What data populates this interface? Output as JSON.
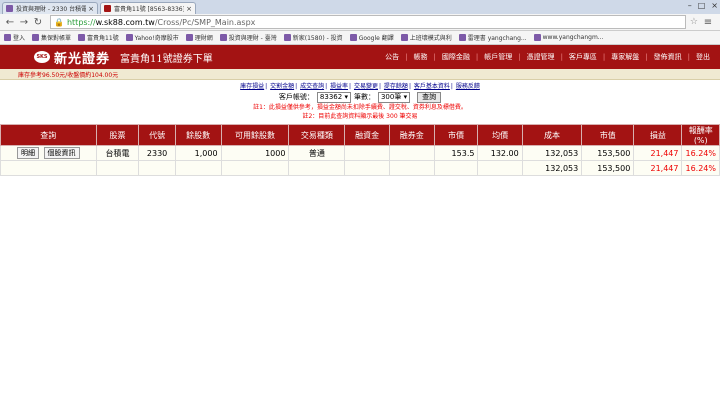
{
  "browser": {
    "tabs": [
      {
        "label": "投資與理財 - 2330 台積電..."
      },
      {
        "label": "富貴角11號 [8563-8336]"
      }
    ],
    "url_scheme": "https://",
    "url_host": "w.sk88.com.tw",
    "url_path": "/Cross/Pc/SMP_Main.aspx",
    "bookmarks": [
      "登入",
      "集保對帳單",
      "富貴角11號",
      "Yahoo!奇摩股市",
      "理財網",
      "投資與理財 - 臺灣",
      "新家(1580) - 投資",
      "Google 翻譯",
      "上班壞模式與利",
      "雷理書 yangchang...",
      "www.yangchangm..."
    ]
  },
  "banner": {
    "logo_text": "SKS",
    "brand": "新光證券",
    "tagline": "富貴角11號證券下單",
    "nav": [
      "公告",
      "帳務",
      "國際金融",
      "帳戶管理",
      "憑證管理",
      "客戶專區",
      "專家解盤",
      "",
      "發佈資訊",
      "登出"
    ]
  },
  "info": {
    "left": "庫存",
    "text": "庫存參考96.50元/收盤價約104.00元"
  },
  "subnav": [
    "庫存損益",
    "交割金額",
    "成交查詢",
    "損益率",
    "交易變更",
    "提存餘額",
    "客戶基本資料",
    "服務反饋"
  ],
  "form": {
    "account_label": "客戶帳號：",
    "account_value": "83362",
    "count_label": "筆數：",
    "count_value": "300筆",
    "query_label": "查詢"
  },
  "notes": [
    "註1：此損益僅供參考，損益金額尚未扣除手續費、證交稅、資券利息及標借費。",
    "註2：目前此查詢資料顯示最後 300 筆交易"
  ],
  "table": {
    "headers": [
      "查詢",
      "股票",
      "代號",
      "餘股數",
      "可用餘股數",
      "交易種類",
      "融資金",
      "融券金",
      "市價",
      "均價",
      "成本",
      "市值",
      "損益",
      "報酬率(%)"
    ],
    "row": {
      "btn_detail": "明細",
      "btn_info": "個股資訊",
      "stock": "台積電",
      "code": "2330",
      "shares": "1,000",
      "avail": "1000",
      "type": "普通",
      "margin": "",
      "short": "",
      "price": "153.5",
      "avg": "132.00",
      "cost": "132,053",
      "value": "153,500",
      "pl": "21,447",
      "ret": "16.24%"
    },
    "total": {
      "cost": "132,053",
      "value": "153,500",
      "pl": "21,447",
      "ret": "16.24%"
    }
  }
}
